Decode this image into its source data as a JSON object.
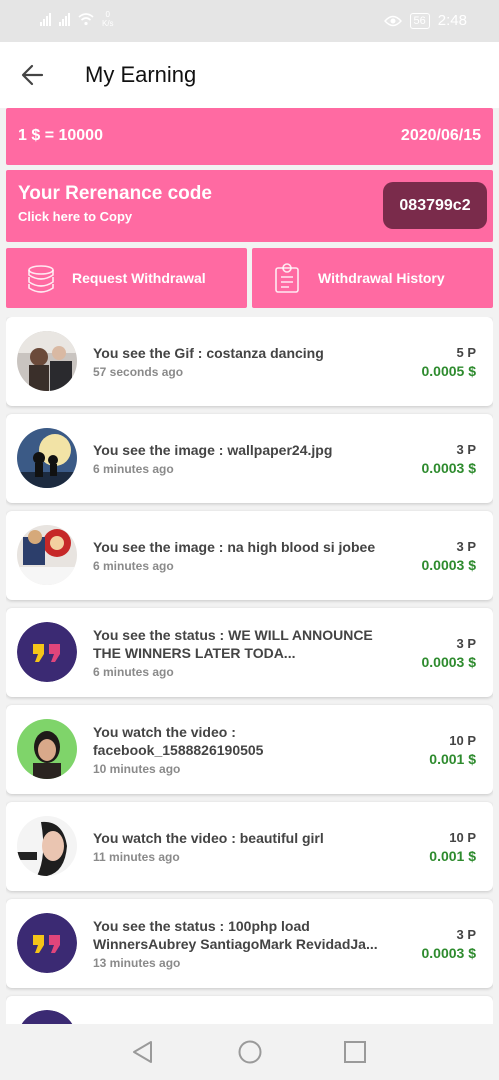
{
  "status_bar": {
    "speed_value": "0",
    "speed_unit": "K/s",
    "battery": "56",
    "time": "2:48",
    "icons": [
      "signal-icon",
      "signal-icon",
      "wifi-icon",
      "eye-icon",
      "battery-icon"
    ]
  },
  "header": {
    "title": "My Earning",
    "back_icon": "arrow-left-icon"
  },
  "rate": {
    "conversion": "1 $ = 10000",
    "date": "2020/06/15"
  },
  "referral": {
    "title": "Your Rerenance code",
    "subtitle": "Click here to Copy",
    "code": "083799c2"
  },
  "actions": {
    "withdraw_label": "Request Withdrawal",
    "history_label": "Withdrawal History"
  },
  "colors": {
    "accent": "#ff6aa2",
    "code_bg": "#7a2b4b",
    "usd_green": "#2e8b2e"
  },
  "earnings": [
    {
      "title": "You see the Gif : costanza dancing",
      "time": "57 seconds ago",
      "points": "5 P",
      "usd": "0.0005 $",
      "avatar": "gif-thumbnail"
    },
    {
      "title": "You see the image : wallpaper24.jpg",
      "time": "6 minutes ago",
      "points": "3 P",
      "usd": "0.0003 $",
      "avatar": "image-thumbnail"
    },
    {
      "title": "You see the image : na high blood si jobee",
      "time": "6 minutes ago",
      "points": "3 P",
      "usd": "0.0003 $",
      "avatar": "image-thumbnail"
    },
    {
      "title": "You see the status : WE WILL ANNOUNCE THE WINNERS LATER TODA...",
      "time": "6 minutes ago",
      "points": "3 P",
      "usd": "0.0003 $",
      "avatar": "quote-icon"
    },
    {
      "title": "You watch the video : facebook_1588826190505",
      "time": "10 minutes ago",
      "points": "10 P",
      "usd": "0.001 $",
      "avatar": "video-thumbnail"
    },
    {
      "title": "You watch the video : beautiful girl",
      "time": "11 minutes ago",
      "points": "10 P",
      "usd": "0.001 $",
      "avatar": "video-thumbnail"
    },
    {
      "title": "You see the status : 100php load WinnersAubrey SantiagoMark RevidadJa...",
      "time": "13 minutes ago",
      "points": "3 P",
      "usd": "0.0003 $",
      "avatar": "quote-icon"
    }
  ],
  "nav": [
    "back-triangle-icon",
    "home-circle-icon",
    "recents-square-icon"
  ]
}
